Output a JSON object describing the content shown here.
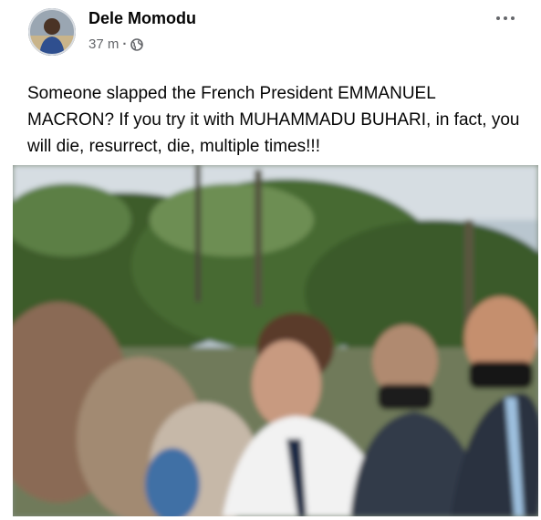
{
  "post": {
    "author_name": "Dele Momodu",
    "timestamp": "37 m",
    "separator": "·",
    "privacy_icon": "globe-icon",
    "more_icon": "more-options-icon",
    "text": "Someone slapped the French President EMMANUEL MACRON? If you try it with MUHAMMADU BUHARI, in fact, you will die, resurrect, die, multiple times!!!"
  },
  "colors": {
    "text_primary": "#050505",
    "text_secondary": "#65676b"
  }
}
